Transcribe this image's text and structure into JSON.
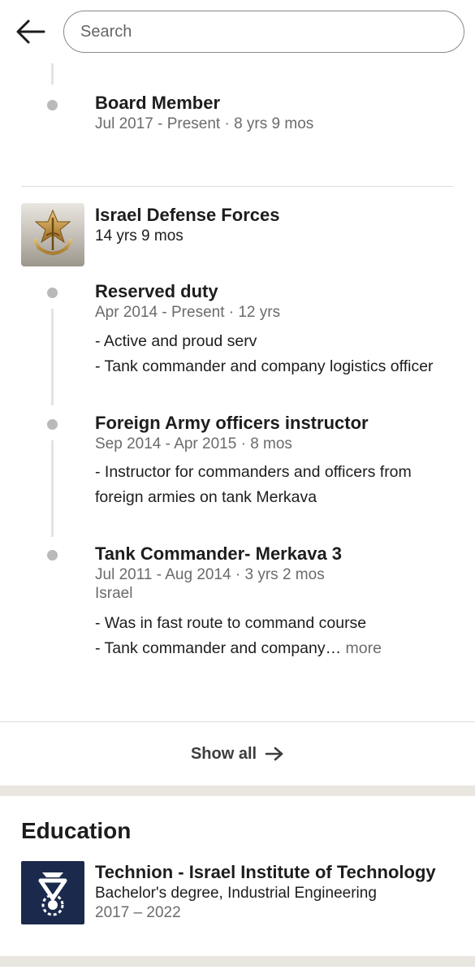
{
  "search": {
    "placeholder": "Search"
  },
  "experience": {
    "previous_role": {
      "title": "Board Member",
      "dates": "Jul 2017 - Present · 8 yrs 9 mos"
    },
    "company": {
      "name": "Israel Defense Forces",
      "duration": "14 yrs 9 mos",
      "logo": "idf-emblem"
    },
    "roles": [
      {
        "title": "Reserved duty",
        "dates": "Apr 2014 - Present · 12 yrs",
        "desc": [
          "- Active and proud serv",
          "- Tank commander and company logistics officer"
        ]
      },
      {
        "title": "Foreign Army officers instructor",
        "dates": "Sep 2014 - Apr 2015 · 8 mos",
        "desc": [
          "- Instructor for commanders and officers from",
          "foreign armies on tank Merkava"
        ]
      },
      {
        "title": "Tank Commander- Merkava 3",
        "dates": "Jul 2011 - Aug 2014 · 3 yrs 2 mos",
        "location": "Israel",
        "desc": [
          "- Was in fast route to command course",
          "- Tank commander and company…"
        ],
        "more": "more"
      }
    ],
    "show_all": "Show all"
  },
  "education": {
    "heading": "Education",
    "school": "Technion - Israel Institute of Technology",
    "degree": "Bachelor's degree, Industrial Engineering",
    "years": "2017 – 2022",
    "logo": "technion-logo"
  },
  "colors": {
    "text": "#1d1d1d",
    "muted": "#6b6b6b",
    "timeline_dot": "#b9b9b9",
    "band": "#e9e5df",
    "technion_navy": "#1b2a4c"
  },
  "icons": {
    "back": "arrow-left-icon",
    "show_all_arrow": "arrow-right-icon"
  }
}
